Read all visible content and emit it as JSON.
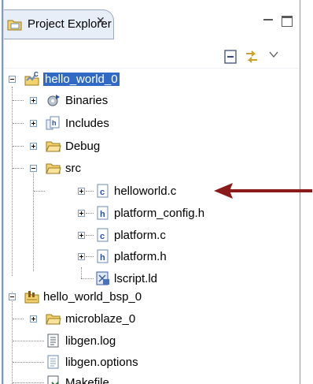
{
  "view": {
    "title": "Project Explorer",
    "close_symbol": "✕"
  },
  "tree": [
    {
      "label": "hello_world_0",
      "icon": "c-project-icon",
      "selected": true
    },
    {
      "label": "Binaries",
      "icon": "binaries-icon"
    },
    {
      "label": "Includes",
      "icon": "includes-icon"
    },
    {
      "label": "Debug",
      "icon": "folder-icon"
    },
    {
      "label": "src",
      "icon": "folder-icon"
    },
    {
      "label": "helloworld.c",
      "icon": "c-file-icon"
    },
    {
      "label": "platform_config.h",
      "icon": "h-file-icon"
    },
    {
      "label": "platform.c",
      "icon": "c-file-icon"
    },
    {
      "label": "platform.h",
      "icon": "h-file-icon"
    },
    {
      "label": "lscript.ld",
      "icon": "linker-script-icon"
    },
    {
      "label": "hello_world_bsp_0",
      "icon": "bsp-project-icon"
    },
    {
      "label": "microblaze_0",
      "icon": "folder-icon"
    },
    {
      "label": "libgen.log",
      "icon": "text-file-icon"
    },
    {
      "label": "libgen.options",
      "icon": "text-file-icon"
    },
    {
      "label": "Makefile",
      "icon": "makefile-icon"
    }
  ],
  "colors": {
    "selection": "#316ac5",
    "folder": "#f3d36b",
    "arrow": "#8b1a1a"
  }
}
